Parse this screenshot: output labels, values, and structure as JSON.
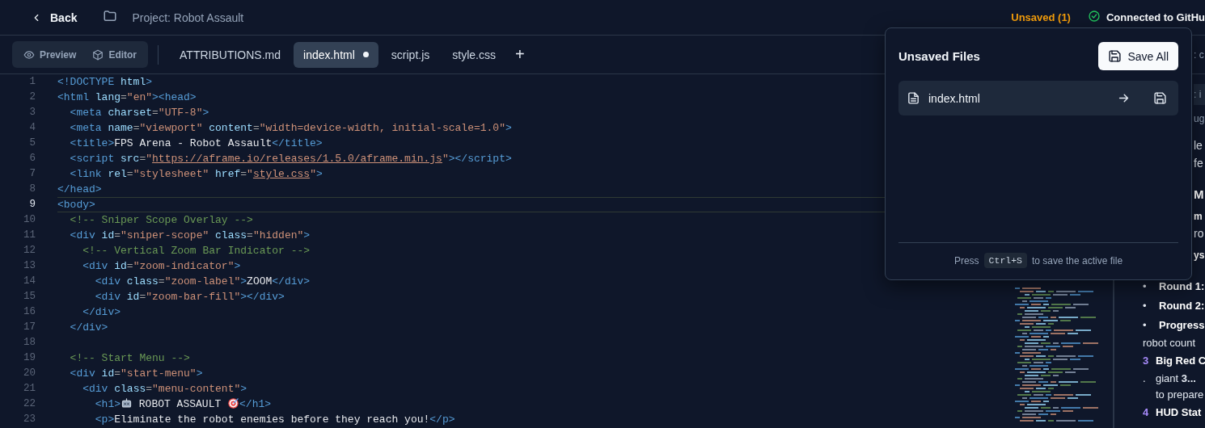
{
  "header": {
    "back": "Back",
    "project": "Project: Robot Assault",
    "unsaved": "Unsaved (1)",
    "connection": "Connected to GitHu"
  },
  "view_modes": [
    {
      "label": "Preview",
      "selected": false
    },
    {
      "label": "Editor",
      "selected": false
    }
  ],
  "tabs": [
    {
      "label": "ATTRIBUTIONS.md",
      "selected": false,
      "modified": false
    },
    {
      "label": "index.html",
      "selected": true,
      "modified": true
    },
    {
      "label": "script.js",
      "selected": false,
      "modified": false
    },
    {
      "label": "style.css",
      "selected": false,
      "modified": false
    }
  ],
  "add_tab": "+",
  "code": [
    {
      "number": "1",
      "active": false,
      "tokens": [
        {
          "kind": "tag",
          "text": "<!DOCTYPE"
        },
        {
          "kind": "attr",
          "text": " html"
        },
        {
          "kind": "tag",
          "text": ">"
        }
      ]
    },
    {
      "number": "2",
      "active": false,
      "tokens": [
        {
          "kind": "tag",
          "text": "<html"
        },
        {
          "kind": "attr",
          "text": " lang"
        },
        {
          "kind": "punct",
          "text": "="
        },
        {
          "kind": "string",
          "text": "\"en\""
        },
        {
          "kind": "tag",
          "text": "><head>"
        }
      ]
    },
    {
      "number": "3",
      "active": false,
      "tokens": [
        {
          "kind": "tag",
          "text": "  <meta"
        },
        {
          "kind": "attr",
          "text": " charset"
        },
        {
          "kind": "punct",
          "text": "="
        },
        {
          "kind": "string",
          "text": "\"UTF-8\""
        },
        {
          "kind": "tag",
          "text": ">"
        }
      ]
    },
    {
      "number": "4",
      "active": false,
      "tokens": [
        {
          "kind": "tag",
          "text": "  <meta"
        },
        {
          "kind": "attr",
          "text": " name"
        },
        {
          "kind": "punct",
          "text": "="
        },
        {
          "kind": "string",
          "text": "\"viewport\""
        },
        {
          "kind": "attr",
          "text": " content"
        },
        {
          "kind": "punct",
          "text": "="
        },
        {
          "kind": "string",
          "text": "\"width=device-width, initial-scale=1.0\""
        },
        {
          "kind": "tag",
          "text": ">"
        }
      ]
    },
    {
      "number": "5",
      "active": false,
      "tokens": [
        {
          "kind": "tag",
          "text": "  <title>"
        },
        {
          "kind": "text",
          "text": "FPS Arena - Robot Assault"
        },
        {
          "kind": "tag",
          "text": "</title>"
        }
      ]
    },
    {
      "number": "6",
      "active": false,
      "tokens": [
        {
          "kind": "tag",
          "text": "  <script"
        },
        {
          "kind": "attr",
          "text": " src"
        },
        {
          "kind": "punct",
          "text": "="
        },
        {
          "kind": "string",
          "text": "\""
        },
        {
          "kind": "link",
          "text": "https://aframe.io/releases/1.5.0/aframe.min.js"
        },
        {
          "kind": "string",
          "text": "\""
        },
        {
          "kind": "tag",
          "text": "></script>"
        }
      ]
    },
    {
      "number": "7",
      "active": false,
      "tokens": [
        {
          "kind": "tag",
          "text": "  <link"
        },
        {
          "kind": "attr",
          "text": " rel"
        },
        {
          "kind": "punct",
          "text": "="
        },
        {
          "kind": "string",
          "text": "\"stylesheet\""
        },
        {
          "kind": "attr",
          "text": " href"
        },
        {
          "kind": "punct",
          "text": "="
        },
        {
          "kind": "string",
          "text": "\""
        },
        {
          "kind": "link",
          "text": "style.css"
        },
        {
          "kind": "string",
          "text": "\""
        },
        {
          "kind": "tag",
          "text": ">"
        }
      ]
    },
    {
      "number": "8",
      "active": false,
      "tokens": [
        {
          "kind": "tag",
          "text": "</head>"
        }
      ]
    },
    {
      "number": "9",
      "active": true,
      "tokens": [
        {
          "kind": "tag",
          "text": "<body>"
        }
      ]
    },
    {
      "number": "10",
      "active": false,
      "tokens": [
        {
          "kind": "comment",
          "text": "  <!-- Sniper Scope Overlay -->"
        }
      ]
    },
    {
      "number": "11",
      "active": false,
      "tokens": [
        {
          "kind": "tag",
          "text": "  <div"
        },
        {
          "kind": "attr",
          "text": " id"
        },
        {
          "kind": "punct",
          "text": "="
        },
        {
          "kind": "string",
          "text": "\"sniper-scope\""
        },
        {
          "kind": "attr",
          "text": " class"
        },
        {
          "kind": "punct",
          "text": "="
        },
        {
          "kind": "string",
          "text": "\"hidden\""
        },
        {
          "kind": "tag",
          "text": ">"
        }
      ]
    },
    {
      "number": "12",
      "active": false,
      "tokens": [
        {
          "kind": "comment",
          "text": "    <!-- Vertical Zoom Bar Indicator -->"
        }
      ]
    },
    {
      "number": "13",
      "active": false,
      "tokens": [
        {
          "kind": "tag",
          "text": "    <div"
        },
        {
          "kind": "attr",
          "text": " id"
        },
        {
          "kind": "punct",
          "text": "="
        },
        {
          "kind": "string",
          "text": "\"zoom-indicator\""
        },
        {
          "kind": "tag",
          "text": ">"
        }
      ]
    },
    {
      "number": "14",
      "active": false,
      "tokens": [
        {
          "kind": "tag",
          "text": "      <div"
        },
        {
          "kind": "attr",
          "text": " class"
        },
        {
          "kind": "punct",
          "text": "="
        },
        {
          "kind": "string",
          "text": "\"zoom-label\""
        },
        {
          "kind": "tag",
          "text": ">"
        },
        {
          "kind": "text",
          "text": "ZOOM"
        },
        {
          "kind": "tag",
          "text": "</div>"
        }
      ]
    },
    {
      "number": "15",
      "active": false,
      "tokens": [
        {
          "kind": "tag",
          "text": "      <div"
        },
        {
          "kind": "attr",
          "text": " id"
        },
        {
          "kind": "punct",
          "text": "="
        },
        {
          "kind": "string",
          "text": "\"zoom-bar-fill\""
        },
        {
          "kind": "tag",
          "text": "></div>"
        }
      ]
    },
    {
      "number": "16",
      "active": false,
      "tokens": [
        {
          "kind": "tag",
          "text": "    </div>"
        }
      ]
    },
    {
      "number": "17",
      "active": false,
      "tokens": [
        {
          "kind": "tag",
          "text": "  </div>"
        }
      ]
    },
    {
      "number": "18",
      "active": false
    },
    {
      "number": "19",
      "active": false,
      "tokens": [
        {
          "kind": "comment",
          "text": "  <!-- Start Menu -->"
        }
      ]
    },
    {
      "number": "20",
      "active": false,
      "tokens": [
        {
          "kind": "tag",
          "text": "  <div"
        },
        {
          "kind": "attr",
          "text": " id"
        },
        {
          "kind": "punct",
          "text": "="
        },
        {
          "kind": "string",
          "text": "\"start-menu\""
        },
        {
          "kind": "tag",
          "text": ">"
        }
      ]
    },
    {
      "number": "21",
      "active": false,
      "tokens": [
        {
          "kind": "tag",
          "text": "    <div"
        },
        {
          "kind": "attr",
          "text": " class"
        },
        {
          "kind": "punct",
          "text": "="
        },
        {
          "kind": "string",
          "text": "\"menu-content\""
        },
        {
          "kind": "tag",
          "text": ">"
        }
      ]
    },
    {
      "number": "22",
      "active": false,
      "tokens": [
        {
          "kind": "tag",
          "text": "      <h1>"
        },
        {
          "kind": "robot_emoji"
        },
        {
          "kind": "text",
          "text": " ROBOT ASSAULT "
        },
        {
          "kind": "target_emoji"
        },
        {
          "kind": "tag",
          "text": "</h1>"
        }
      ]
    },
    {
      "number": "23",
      "active": false,
      "tokens": [
        {
          "kind": "tag",
          "text": "      <p>"
        },
        {
          "kind": "text",
          "text": "Eliminate the robot enemies before they reach you!"
        },
        {
          "kind": "tag",
          "text": "</p>"
        }
      ]
    }
  ],
  "right_panel": {
    "header_fragment": ": c",
    "covered_lines": [
      {
        "kind": "field",
        "text": ": i"
      },
      {
        "kind": "muted",
        "text": "ug"
      },
      {
        "kind": "text",
        "text": "le"
      },
      {
        "kind": "text",
        "text": "fe"
      },
      {
        "kind": "heading",
        "text": "M"
      },
      {
        "kind": "bold",
        "text": "m"
      },
      {
        "kind": "text",
        "text": "ro"
      },
      {
        "kind": "bold",
        "text": "ys"
      }
    ],
    "lines": [
      {
        "kind": "bullet",
        "marker": "•",
        "text": "Round 1:"
      },
      {
        "kind": "bullet",
        "marker": "•",
        "text": "Round 2:"
      },
      {
        "kind": "bullet",
        "marker": "•",
        "text": "Progress"
      },
      {
        "kind": "plain",
        "text": "robot count"
      },
      {
        "kind": "numbered",
        "marker": "3",
        "text": "Big Red C"
      },
      {
        "kind": "continued",
        "marker": ".",
        "text": "giant **3...**"
      },
      {
        "kind": "continued",
        "text": "to prepare"
      },
      {
        "kind": "numbered",
        "marker": "4",
        "text": "HUD Stat"
      }
    ]
  },
  "popover": {
    "title": "Unsaved Files",
    "save_all": "Save All",
    "files": [
      {
        "name": "index.html"
      }
    ],
    "hint_before": "Press",
    "shortcut": "Ctrl+S",
    "hint_after": "to save the active file"
  }
}
